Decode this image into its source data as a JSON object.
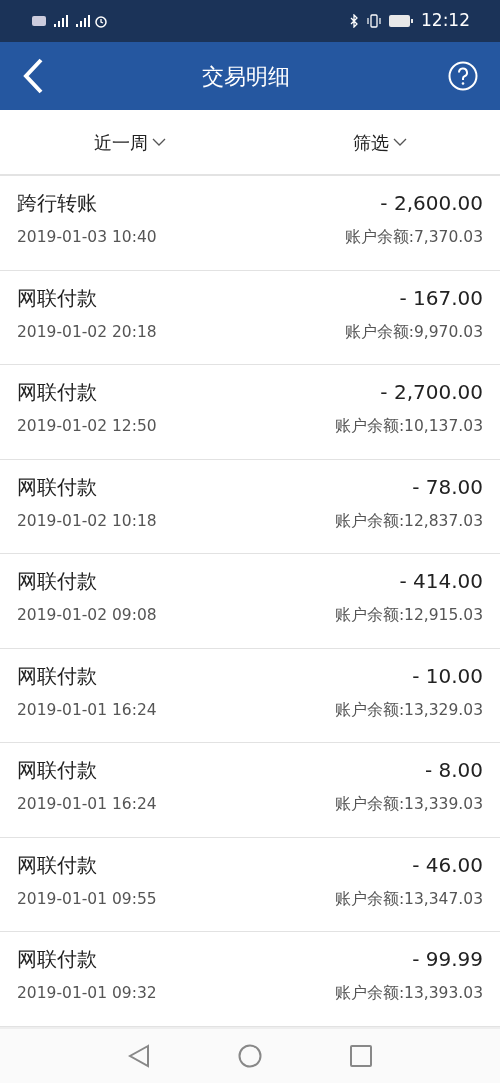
{
  "status_bar": {
    "time": "12:12"
  },
  "header": {
    "title": "交易明细"
  },
  "filters": [
    {
      "label": "近一周"
    },
    {
      "label": "筛选"
    }
  ],
  "transactions": [
    {
      "name": "跨行转账",
      "amount": "- 2,600.00",
      "time": "2019-01-03 10:40",
      "balance": "账户余额:7,370.03"
    },
    {
      "name": "网联付款",
      "amount": "- 167.00",
      "time": "2019-01-02 20:18",
      "balance": "账户余额:9,970.03"
    },
    {
      "name": "网联付款",
      "amount": "- 2,700.00",
      "time": "2019-01-02 12:50",
      "balance": "账户余额:10,137.03"
    },
    {
      "name": "网联付款",
      "amount": "- 78.00",
      "time": "2019-01-02 10:18",
      "balance": "账户余额:12,837.03"
    },
    {
      "name": "网联付款",
      "amount": "- 414.00",
      "time": "2019-01-02 09:08",
      "balance": "账户余额:12,915.03"
    },
    {
      "name": "网联付款",
      "amount": "- 10.00",
      "time": "2019-01-01 16:24",
      "balance": "账户余额:13,329.03"
    },
    {
      "name": "网联付款",
      "amount": "- 8.00",
      "time": "2019-01-01 16:24",
      "balance": "账户余额:13,339.03"
    },
    {
      "name": "网联付款",
      "amount": "- 46.00",
      "time": "2019-01-01 09:55",
      "balance": "账户余额:13,347.03"
    },
    {
      "name": "网联付款",
      "amount": "- 99.99",
      "time": "2019-01-01 09:32",
      "balance": "账户余额:13,393.03"
    }
  ]
}
